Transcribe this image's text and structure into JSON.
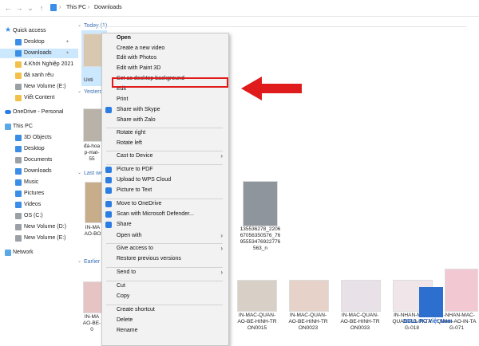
{
  "address_bar": {
    "back": "←",
    "forward": "→",
    "recent": "⌄",
    "up": "↑",
    "path": [
      "This PC",
      "Downloads"
    ],
    "separator": "›"
  },
  "sidebar": {
    "items": [
      {
        "label": "Quick access",
        "icon": "star-icon",
        "selected": false
      },
      {
        "label": "Desktop",
        "icon": "desktop-icon",
        "selected": false,
        "pinned": true
      },
      {
        "label": "Downloads",
        "icon": "download-icon",
        "selected": true,
        "pinned": true
      },
      {
        "label": "4.Khởi Nghiệp 2021",
        "icon": "folder-icon",
        "selected": false
      },
      {
        "label": "đá xanh rêu",
        "icon": "folder-icon",
        "selected": false
      },
      {
        "label": "New Volume (E:)",
        "icon": "drive-icon",
        "selected": false
      },
      {
        "label": "Viết Content",
        "icon": "folder-icon",
        "selected": false
      },
      {
        "label": "OneDrive - Personal",
        "icon": "cloud-icon",
        "selected": false
      },
      {
        "label": "This PC",
        "icon": "pc-icon",
        "selected": false
      },
      {
        "label": "3D Objects",
        "icon": "cube-icon",
        "selected": false
      },
      {
        "label": "Desktop",
        "icon": "desktop-icon",
        "selected": false
      },
      {
        "label": "Documents",
        "icon": "document-icon",
        "selected": false
      },
      {
        "label": "Downloads",
        "icon": "download-icon",
        "selected": false
      },
      {
        "label": "Music",
        "icon": "music-icon",
        "selected": false
      },
      {
        "label": "Pictures",
        "icon": "pictures-icon",
        "selected": false
      },
      {
        "label": "Videos",
        "icon": "video-icon",
        "selected": false
      },
      {
        "label": "OS (C:)",
        "icon": "drive-icon",
        "selected": false
      },
      {
        "label": "New Volume (D:)",
        "icon": "drive-icon",
        "selected": false
      },
      {
        "label": "New Volume (E:)",
        "icon": "drive-icon",
        "selected": false
      },
      {
        "label": "Network",
        "icon": "network-icon",
        "selected": false
      }
    ]
  },
  "content": {
    "sections": [
      {
        "label": "Today (1)"
      },
      {
        "label": "Yesterday"
      },
      {
        "label": "Last week"
      },
      {
        "label": "Earlier this"
      }
    ],
    "captions": {
      "today_1": "Unti",
      "yesterday_1": "đá-hoa\np-mat-\n55",
      "lastweek_1": "IN-MA\nAO-BO",
      "lastweek_2": "135536278_2206\n67056350576_76\n95553476922776\n563_n",
      "earlier_1": "IN-MA\nAO-BE-\n0",
      "earlier_2": "IN-MAC-QUAN-\nAO-BE-HINH-TR\nON0015",
      "earlier_3": "IN-MAC-QUAN-\nAO-BE-HINH-TR\nON0023",
      "earlier_4": "IN-MAC-QUAN-\nAO-BE-HINH-TR\nON0033",
      "earlier_5": "IN-NHAN-MAC-\nQUAN-AO-IN-TA\nG-018",
      "earlier_6": "IN-NHAN-MAC-\nQUAN-AO-IN-TA\nG-071"
    }
  },
  "context_menu": {
    "items": [
      {
        "label": "Open",
        "bold": true
      },
      {
        "label": "Create a new video"
      },
      {
        "label": "Edit with Photos"
      },
      {
        "label": "Edit with Paint 3D"
      },
      {
        "label": "Set as desktop background",
        "highlighted": true
      },
      {
        "label": "Edit"
      },
      {
        "label": "Print"
      },
      {
        "label": "Share with Skype",
        "icon": "skype-icon"
      },
      {
        "label": "Share with Zalo"
      },
      {
        "label": "Rotate right"
      },
      {
        "label": "Rotate left"
      },
      {
        "label": "Cast to Device",
        "submenu": true
      },
      {
        "label": "Picture to PDF",
        "icon": "pdf-icon"
      },
      {
        "label": "Upload to WPS Cloud",
        "icon": "wps-cloud-icon"
      },
      {
        "label": "Picture to Text",
        "icon": "text-icon"
      },
      {
        "label": "Move to OneDrive",
        "icon": "onedrive-icon"
      },
      {
        "label": "Scan with Microsoft Defender...",
        "icon": "defender-icon"
      },
      {
        "label": "Share",
        "icon": "share-icon"
      },
      {
        "label": "Open with",
        "submenu": true
      },
      {
        "label": "Give access to",
        "submenu": true
      },
      {
        "label": "Restore previous versions"
      },
      {
        "label": "Send to",
        "submenu": true
      },
      {
        "label": "Cut"
      },
      {
        "label": "Copy"
      },
      {
        "label": "Create shortcut"
      },
      {
        "label": "Delete"
      },
      {
        "label": "Rename"
      }
    ],
    "submenu_arrow": "›"
  },
  "watermark": "DELL PC Việt Nam",
  "colors": {
    "selection": "#cce8ff",
    "highlight_box": "#e01b1b",
    "arrow": "#e01b1b",
    "link_blue": "#3b6fb6"
  }
}
